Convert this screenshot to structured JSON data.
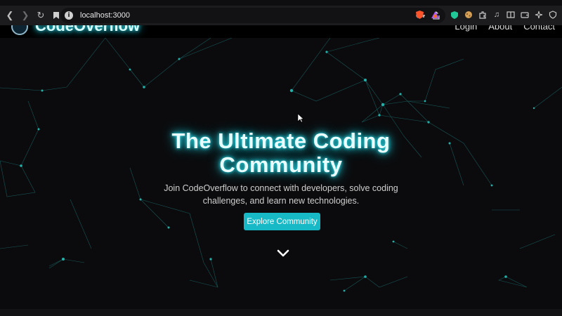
{
  "browser": {
    "url": "localhost:3000",
    "info_icon": "i"
  },
  "header": {
    "logo_text": "CodeOverflow",
    "nav": [
      "Login",
      "About",
      "Contact"
    ]
  },
  "hero": {
    "title_line1": "The Ultimate Coding",
    "title_line2": "Community",
    "subtitle_line1": "Join CodeOverflow to connect with developers, solve coding",
    "subtitle_line2": "challenges, and learn new technologies.",
    "cta_label": "Explore Community"
  },
  "colors": {
    "accent": "#17b9c6",
    "glow": "#26d3e0",
    "background": "#0b0b0d",
    "network_line": "#1a7f7f",
    "network_node": "#20b2aa"
  }
}
